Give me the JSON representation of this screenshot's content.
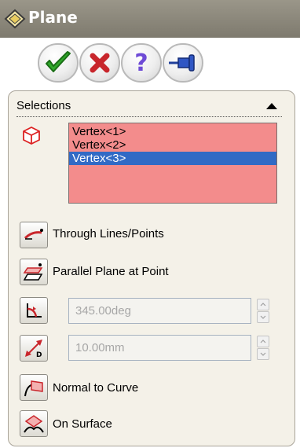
{
  "window": {
    "title": "Plane"
  },
  "action_buttons": [
    {
      "icon": "checkmark-icon",
      "color": "#2fa82a"
    },
    {
      "icon": "x-icon",
      "color": "#c8262c"
    },
    {
      "icon": "help-question-icon",
      "color": "#6e4bd6"
    },
    {
      "icon": "pushpin-icon",
      "color": "#1f3f9a"
    }
  ],
  "selections": {
    "title": "Selections",
    "items": [
      "Vertex<1>",
      "Vertex<2>",
      "Vertex<3>"
    ],
    "selected_index": 2,
    "list_color": "#f38c8c",
    "highlight_color": "#316ac5"
  },
  "options": {
    "through_lines_points": "Through Lines/Points",
    "parallel_plane_at_point": "Parallel Plane at Point",
    "angle_value": "345.00deg",
    "offset_value": "10.00mm",
    "normal_to_curve": "Normal to Curve",
    "on_surface": "On Surface"
  }
}
